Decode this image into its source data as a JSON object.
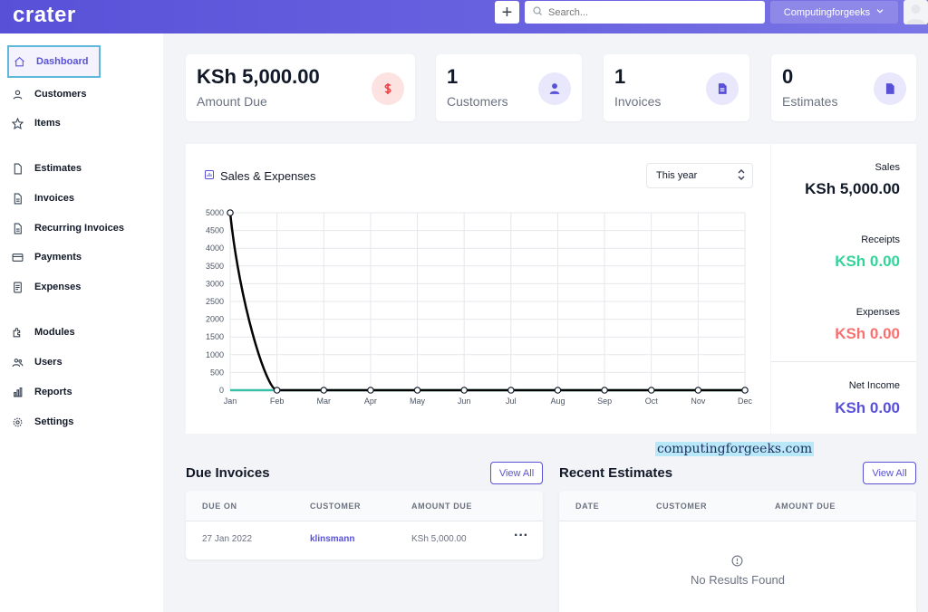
{
  "app": {
    "logo": "crater"
  },
  "topbar": {
    "add_label": "+",
    "search_placeholder": "Search...",
    "company_name": "Computingforgeeks"
  },
  "sidebar": {
    "items": [
      {
        "label": "Dashboard",
        "icon": "home-icon"
      },
      {
        "label": "Customers",
        "icon": "user-icon"
      },
      {
        "label": "Items",
        "icon": "star-icon"
      },
      {
        "label": "Estimates",
        "icon": "document-icon"
      },
      {
        "label": "Invoices",
        "icon": "document-text-icon"
      },
      {
        "label": "Recurring Invoices",
        "icon": "document-text-icon"
      },
      {
        "label": "Payments",
        "icon": "credit-card-icon"
      },
      {
        "label": "Expenses",
        "icon": "receipt-icon"
      },
      {
        "label": "Modules",
        "icon": "puzzle-icon"
      },
      {
        "label": "Users",
        "icon": "users-icon"
      },
      {
        "label": "Reports",
        "icon": "chart-bar-icon"
      },
      {
        "label": "Settings",
        "icon": "cog-icon"
      }
    ]
  },
  "stats": [
    {
      "value": "KSh 5,000.00",
      "label": "Amount Due",
      "icon": "dollar-icon"
    },
    {
      "value": "1",
      "label": "Customers",
      "icon": "user-icon"
    },
    {
      "value": "1",
      "label": "Invoices",
      "icon": "document-text-icon"
    },
    {
      "value": "0",
      "label": "Estimates",
      "icon": "document-icon"
    }
  ],
  "chart_panel": {
    "title": "Sales & Expenses",
    "period_select": "This year"
  },
  "summary": {
    "sales_label": "Sales",
    "sales_value": "KSh 5,000.00",
    "receipts_label": "Receipts",
    "receipts_value": "KSh 0.00",
    "expenses_label": "Expenses",
    "expenses_value": "KSh 0.00",
    "net_income_label": "Net Income",
    "net_income_value": "KSh 0.00",
    "colors": {
      "sales": "#111827",
      "receipts": "#34d399",
      "expenses": "#f87171",
      "net_income": "#5851d8"
    }
  },
  "chart_data": {
    "type": "line",
    "title": "Sales & Expenses",
    "x": [
      "Jan",
      "Feb",
      "Mar",
      "Apr",
      "May",
      "Jun",
      "Jul",
      "Aug",
      "Sep",
      "Oct",
      "Nov",
      "Dec"
    ],
    "ylim": [
      0,
      5000
    ],
    "yticks": [
      0,
      500,
      1000,
      1500,
      2000,
      2500,
      3000,
      3500,
      4000,
      4500,
      5000
    ],
    "grid": true,
    "series": [
      {
        "values": [
          5000,
          0,
          0,
          0,
          0,
          0,
          0,
          0,
          0,
          0,
          0,
          0
        ],
        "color": "#040405"
      },
      {
        "values": [
          0,
          0,
          0,
          0,
          0,
          0,
          0,
          0,
          0,
          0,
          0,
          0
        ],
        "color": "#39c0a8"
      }
    ]
  },
  "due_invoices": {
    "title": "Due Invoices",
    "view_all": "View All",
    "columns": [
      "DUE ON",
      "CUSTOMER",
      "AMOUNT DUE"
    ],
    "rows": [
      {
        "due_on": "27 Jan 2022",
        "customer": "klinsmann",
        "amount_due": "KSh 5,000.00",
        "actions": "···"
      }
    ]
  },
  "recent_estimates": {
    "title": "Recent Estimates",
    "view_all": "View All",
    "columns": [
      "DATE",
      "CUSTOMER",
      "AMOUNT DUE"
    ],
    "empty_text": "No Results Found"
  },
  "watermark": "computingforgeeks.com"
}
